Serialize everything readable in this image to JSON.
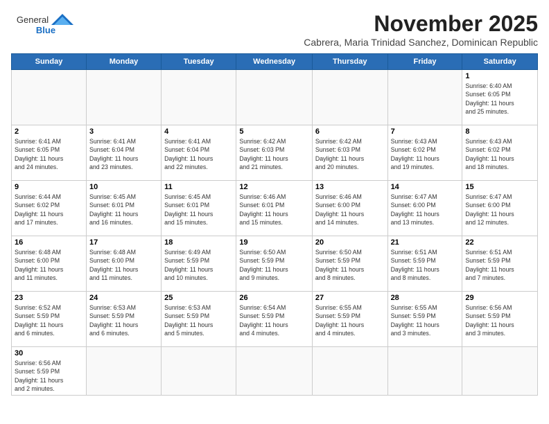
{
  "header": {
    "logo_general": "General",
    "logo_blue": "Blue",
    "month_year": "November 2025",
    "location": "Cabrera, Maria Trinidad Sanchez, Dominican Republic"
  },
  "weekdays": [
    "Sunday",
    "Monday",
    "Tuesday",
    "Wednesday",
    "Thursday",
    "Friday",
    "Saturday"
  ],
  "weeks": [
    [
      {
        "date": "",
        "text": ""
      },
      {
        "date": "",
        "text": ""
      },
      {
        "date": "",
        "text": ""
      },
      {
        "date": "",
        "text": ""
      },
      {
        "date": "",
        "text": ""
      },
      {
        "date": "",
        "text": ""
      },
      {
        "date": "1",
        "text": "Sunrise: 6:40 AM\nSunset: 6:05 PM\nDaylight: 11 hours\nand 25 minutes."
      }
    ],
    [
      {
        "date": "2",
        "text": "Sunrise: 6:41 AM\nSunset: 6:05 PM\nDaylight: 11 hours\nand 24 minutes."
      },
      {
        "date": "3",
        "text": "Sunrise: 6:41 AM\nSunset: 6:04 PM\nDaylight: 11 hours\nand 23 minutes."
      },
      {
        "date": "4",
        "text": "Sunrise: 6:41 AM\nSunset: 6:04 PM\nDaylight: 11 hours\nand 22 minutes."
      },
      {
        "date": "5",
        "text": "Sunrise: 6:42 AM\nSunset: 6:03 PM\nDaylight: 11 hours\nand 21 minutes."
      },
      {
        "date": "6",
        "text": "Sunrise: 6:42 AM\nSunset: 6:03 PM\nDaylight: 11 hours\nand 20 minutes."
      },
      {
        "date": "7",
        "text": "Sunrise: 6:43 AM\nSunset: 6:02 PM\nDaylight: 11 hours\nand 19 minutes."
      },
      {
        "date": "8",
        "text": "Sunrise: 6:43 AM\nSunset: 6:02 PM\nDaylight: 11 hours\nand 18 minutes."
      }
    ],
    [
      {
        "date": "9",
        "text": "Sunrise: 6:44 AM\nSunset: 6:02 PM\nDaylight: 11 hours\nand 17 minutes."
      },
      {
        "date": "10",
        "text": "Sunrise: 6:45 AM\nSunset: 6:01 PM\nDaylight: 11 hours\nand 16 minutes."
      },
      {
        "date": "11",
        "text": "Sunrise: 6:45 AM\nSunset: 6:01 PM\nDaylight: 11 hours\nand 15 minutes."
      },
      {
        "date": "12",
        "text": "Sunrise: 6:46 AM\nSunset: 6:01 PM\nDaylight: 11 hours\nand 15 minutes."
      },
      {
        "date": "13",
        "text": "Sunrise: 6:46 AM\nSunset: 6:00 PM\nDaylight: 11 hours\nand 14 minutes."
      },
      {
        "date": "14",
        "text": "Sunrise: 6:47 AM\nSunset: 6:00 PM\nDaylight: 11 hours\nand 13 minutes."
      },
      {
        "date": "15",
        "text": "Sunrise: 6:47 AM\nSunset: 6:00 PM\nDaylight: 11 hours\nand 12 minutes."
      }
    ],
    [
      {
        "date": "16",
        "text": "Sunrise: 6:48 AM\nSunset: 6:00 PM\nDaylight: 11 hours\nand 11 minutes."
      },
      {
        "date": "17",
        "text": "Sunrise: 6:48 AM\nSunset: 6:00 PM\nDaylight: 11 hours\nand 11 minutes."
      },
      {
        "date": "18",
        "text": "Sunrise: 6:49 AM\nSunset: 5:59 PM\nDaylight: 11 hours\nand 10 minutes."
      },
      {
        "date": "19",
        "text": "Sunrise: 6:50 AM\nSunset: 5:59 PM\nDaylight: 11 hours\nand 9 minutes."
      },
      {
        "date": "20",
        "text": "Sunrise: 6:50 AM\nSunset: 5:59 PM\nDaylight: 11 hours\nand 8 minutes."
      },
      {
        "date": "21",
        "text": "Sunrise: 6:51 AM\nSunset: 5:59 PM\nDaylight: 11 hours\nand 8 minutes."
      },
      {
        "date": "22",
        "text": "Sunrise: 6:51 AM\nSunset: 5:59 PM\nDaylight: 11 hours\nand 7 minutes."
      }
    ],
    [
      {
        "date": "23",
        "text": "Sunrise: 6:52 AM\nSunset: 5:59 PM\nDaylight: 11 hours\nand 6 minutes."
      },
      {
        "date": "24",
        "text": "Sunrise: 6:53 AM\nSunset: 5:59 PM\nDaylight: 11 hours\nand 6 minutes."
      },
      {
        "date": "25",
        "text": "Sunrise: 6:53 AM\nSunset: 5:59 PM\nDaylight: 11 hours\nand 5 minutes."
      },
      {
        "date": "26",
        "text": "Sunrise: 6:54 AM\nSunset: 5:59 PM\nDaylight: 11 hours\nand 4 minutes."
      },
      {
        "date": "27",
        "text": "Sunrise: 6:55 AM\nSunset: 5:59 PM\nDaylight: 11 hours\nand 4 minutes."
      },
      {
        "date": "28",
        "text": "Sunrise: 6:55 AM\nSunset: 5:59 PM\nDaylight: 11 hours\nand 3 minutes."
      },
      {
        "date": "29",
        "text": "Sunrise: 6:56 AM\nSunset: 5:59 PM\nDaylight: 11 hours\nand 3 minutes."
      }
    ],
    [
      {
        "date": "30",
        "text": "Sunrise: 6:56 AM\nSunset: 5:59 PM\nDaylight: 11 hours\nand 2 minutes."
      },
      {
        "date": "",
        "text": ""
      },
      {
        "date": "",
        "text": ""
      },
      {
        "date": "",
        "text": ""
      },
      {
        "date": "",
        "text": ""
      },
      {
        "date": "",
        "text": ""
      },
      {
        "date": "",
        "text": ""
      }
    ]
  ]
}
